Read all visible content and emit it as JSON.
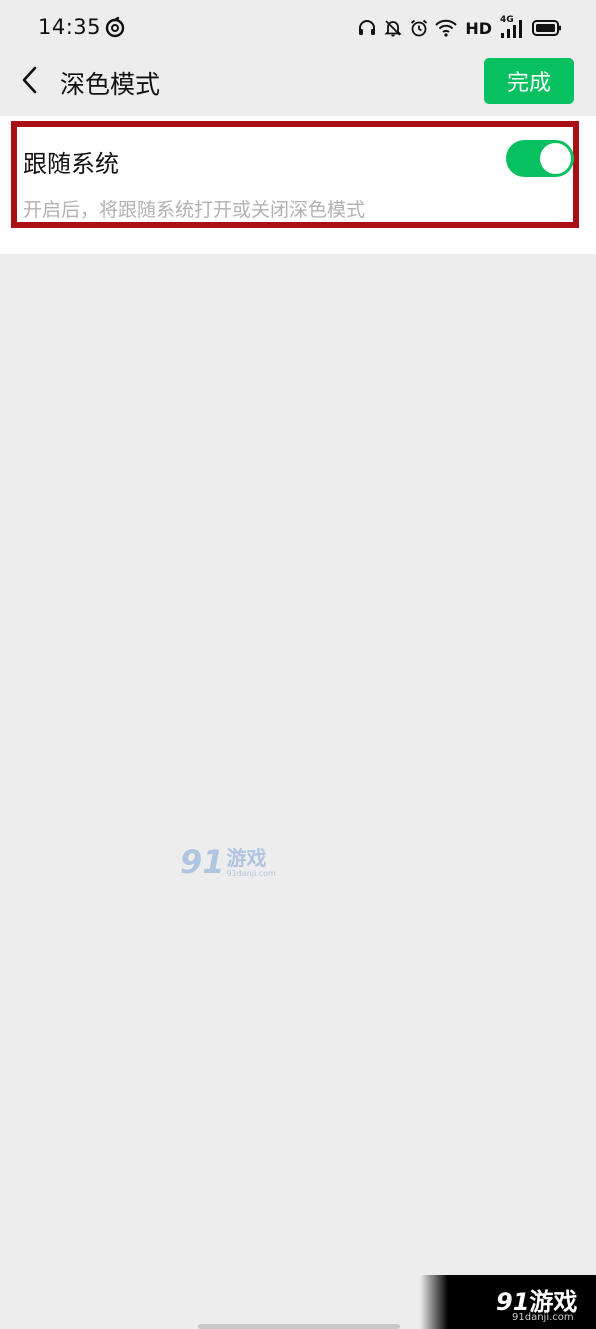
{
  "status_bar": {
    "time": "14:35",
    "network_label": "HD",
    "signal_label": "4G",
    "icons": [
      "netease-music-icon",
      "headset-icon",
      "mute-bell-icon",
      "alarm-icon",
      "wifi-icon",
      "cellular-signal-icon",
      "battery-icon"
    ]
  },
  "nav": {
    "back_icon": "chevron-left-icon",
    "title": "深色模式",
    "done_label": "完成"
  },
  "setting": {
    "title": "跟随系统",
    "description": "开启后，将跟随系统打开或关闭深色模式",
    "toggle_on": true
  },
  "watermark": {
    "number": "91",
    "text": "游戏",
    "url": "91danji.com"
  },
  "colors": {
    "accent": "#07c160",
    "highlight": "#a81016",
    "background": "#ededed"
  }
}
